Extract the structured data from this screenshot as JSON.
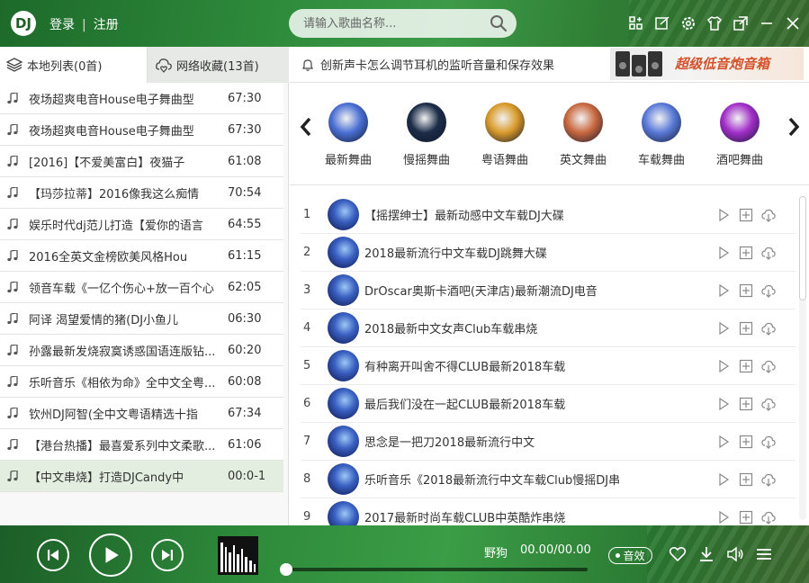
{
  "header": {
    "logo_text": "DJ",
    "login_label": "登录",
    "separator": "|",
    "register_label": "注册",
    "search_placeholder": "请输入歌曲名称...",
    "icons": [
      "apps-icon",
      "edit-icon",
      "settings-icon",
      "shirt-icon",
      "mini-mode-icon",
      "minimize-icon",
      "close-icon"
    ]
  },
  "left_panel": {
    "tabs": [
      {
        "label": "本地列表(0首)",
        "icon": "local-list-icon",
        "selected": false
      },
      {
        "label": "网络收藏(13首)",
        "icon": "cloud-favorite-icon",
        "selected": true
      }
    ],
    "songs": [
      {
        "title": "夜场超爽电音House电子舞曲型",
        "duration": "67:30"
      },
      {
        "title": "夜场超爽电音House电子舞曲型",
        "duration": "67:30"
      },
      {
        "title": "[2016]【不爱美富白】夜猫子",
        "duration": "61:08"
      },
      {
        "title": "【玛莎拉蒂】2016像我这么痴情",
        "duration": "70:54"
      },
      {
        "title": "娱乐时代dj范儿打造【爱你的语言",
        "duration": "64:55"
      },
      {
        "title": "2016全英文金榜欧美风格Hou",
        "duration": "61:15"
      },
      {
        "title": "领音车载《一亿个伤心+放一百个心",
        "duration": "62:05"
      },
      {
        "title": "阿译  渴望爱情的猪(DJ小鱼儿",
        "duration": "06:30"
      },
      {
        "title": "孙露最新发烧寂寞诱惑国语连版钻...",
        "duration": "60:20"
      },
      {
        "title": "乐听音乐《相依为命》全中文全粤...",
        "duration": "60:08"
      },
      {
        "title": "钦州DJ阿智(全中文粤语精选十指",
        "duration": "67:34"
      },
      {
        "title": "【港台热播】最喜爱系列中文柔歌...",
        "duration": "61:06"
      },
      {
        "title": "【中文串烧】打造DJCandy中",
        "duration": "00:0-1"
      }
    ],
    "active_index": 12
  },
  "right_panel": {
    "notice": "创新声卡怎么调节耳机的监听音量和保存效果",
    "banner_text": "超级低音炮音箱",
    "categories": [
      {
        "label": "最新舞曲",
        "color": "#4a6fd4"
      },
      {
        "label": "慢摇舞曲",
        "color": "#1c2c48"
      },
      {
        "label": "粤语舞曲",
        "color": "#d99a2a"
      },
      {
        "label": "英文舞曲",
        "color": "#c9683f"
      },
      {
        "label": "车载舞曲",
        "color": "#5a7ad8"
      },
      {
        "label": "酒吧舞曲",
        "color": "#a22fc9"
      }
    ],
    "tracks": [
      {
        "num": "1",
        "title": "【摇摆绅士】最新动感中文车载DJ大碟"
      },
      {
        "num": "2",
        "title": "2018最新流行中文车载DJ跳舞大碟"
      },
      {
        "num": "3",
        "title": "DrOscar奥斯卡酒吧(天津店)最新潮流DJ电音"
      },
      {
        "num": "4",
        "title": "2018最新中文女声Club车载串烧"
      },
      {
        "num": "5",
        "title": "有种离开叫舍不得CLUB最新2018车载"
      },
      {
        "num": "6",
        "title": "最后我们没在一起CLUB最新2018车载"
      },
      {
        "num": "7",
        "title": "思念是一把刀2018最新流行中文"
      },
      {
        "num": "8",
        "title": "乐听音乐《2018最新流行中文车载Club慢摇DJ串"
      },
      {
        "num": "9",
        "title": "2017最新时尚车载CLUB中英酷炸串烧"
      }
    ]
  },
  "player": {
    "now_playing": "野狗",
    "time": "00.00/00.00",
    "sound_effect_label": "音效",
    "progress": 0,
    "equalizer_levels": [
      0.9,
      0.75,
      0.6,
      0.8,
      0.55,
      0.7,
      0.45,
      0.35,
      0.25
    ]
  }
}
